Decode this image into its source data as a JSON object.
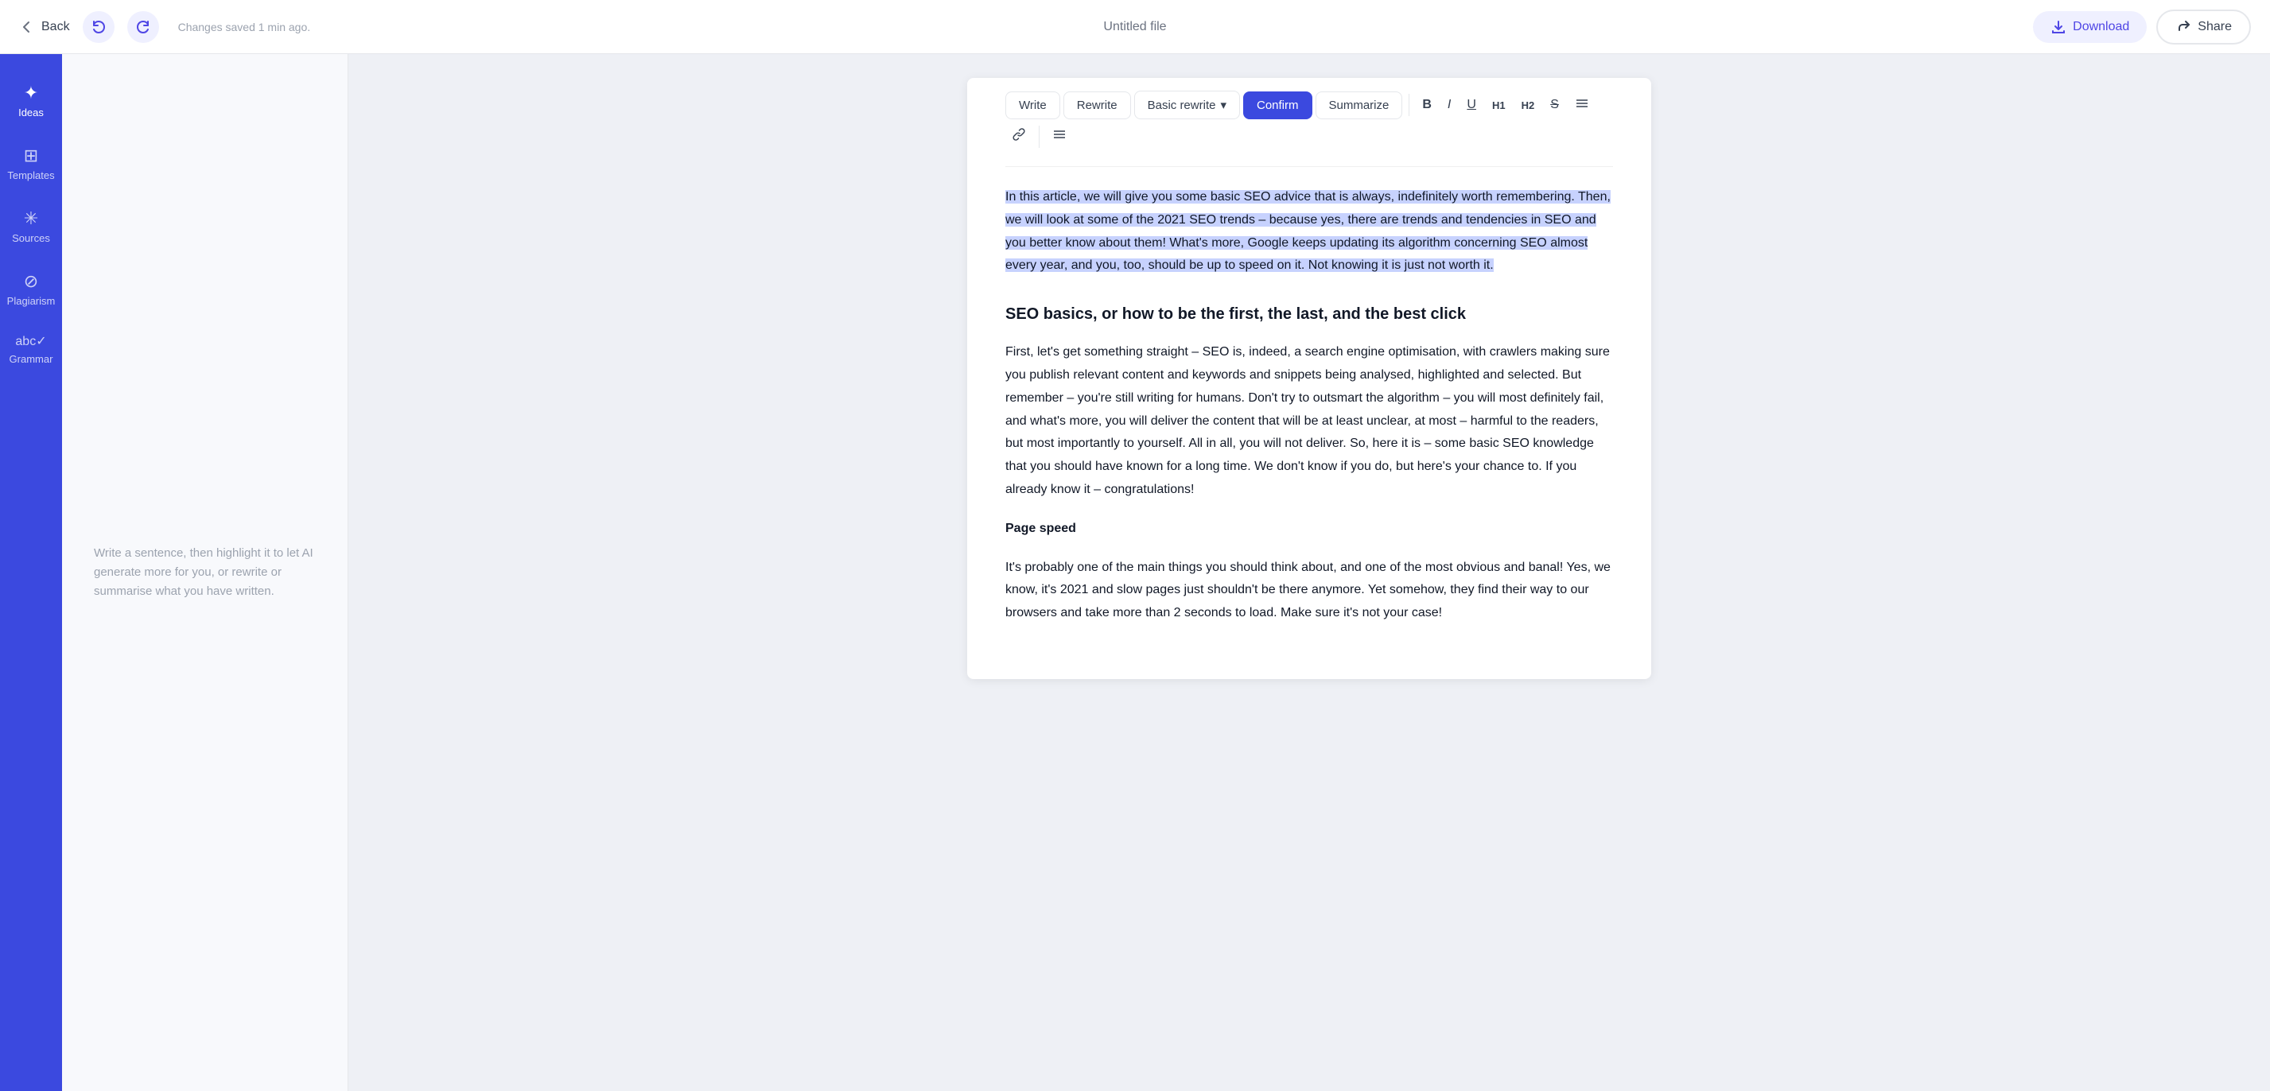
{
  "topbar": {
    "back_label": "Back",
    "saved_text": "Changes saved 1 min ago.",
    "file_title": "Untitled file",
    "download_label": "Download",
    "share_label": "Share"
  },
  "sidebar": {
    "items": [
      {
        "id": "ideas",
        "label": "Ideas",
        "icon": "✦"
      },
      {
        "id": "templates",
        "label": "Templates",
        "icon": "⊞"
      },
      {
        "id": "sources",
        "label": "Sources",
        "icon": "✳"
      },
      {
        "id": "plagiarism",
        "label": "Plagiarism",
        "icon": "⊘"
      },
      {
        "id": "grammar",
        "label": "Grammar",
        "icon": "abc✓"
      }
    ]
  },
  "hint": {
    "text": "Write a sentence, then highlight it to let AI generate more for you, or rewrite or summarise what you have written."
  },
  "toolbar": {
    "write_label": "Write",
    "rewrite_label": "Rewrite",
    "basic_rewrite_label": "Basic rewrite",
    "confirm_label": "Confirm",
    "summarize_label": "Summarize"
  },
  "content": {
    "selected_paragraph": "In this article, we will give you some basic SEO advice that is always, indefinitely worth remembering. Then, we will look at some of the 2021 SEO trends – because yes, there are trends and tendencies in SEO and you better know about them! What's more, Google keeps updating its algorithm concerning SEO almost every year, and you, too, should be up to speed on it. Not knowing it is just not worth it.",
    "heading1": "SEO basics, or how to be the first, the last, and the best click",
    "paragraph1": "First, let's get something straight – SEO is, indeed, a search engine optimisation, with crawlers making sure you publish relevant content and keywords and snippets being analysed, highlighted and selected. But remember – you're still writing for humans. Don't try to outsmart the algorithm – you will most definitely fail, and what's more, you will deliver the content that will be at least unclear, at most – harmful to the readers, but most importantly to yourself. All in all, you will not deliver. So, here it is – some basic SEO knowledge that you should have known for a long time. We don't know if you do, but here's your chance to. If you already know it – congratulations!",
    "heading2": "Page speed",
    "paragraph2": "It's probably one of the main things you should think about, and one of the most obvious and banal! Yes, we know, it's 2021 and slow pages just shouldn't be there anymore. Yet somehow, they find their way to our browsers and take more than 2 seconds to load. Make sure it's not your case!"
  }
}
